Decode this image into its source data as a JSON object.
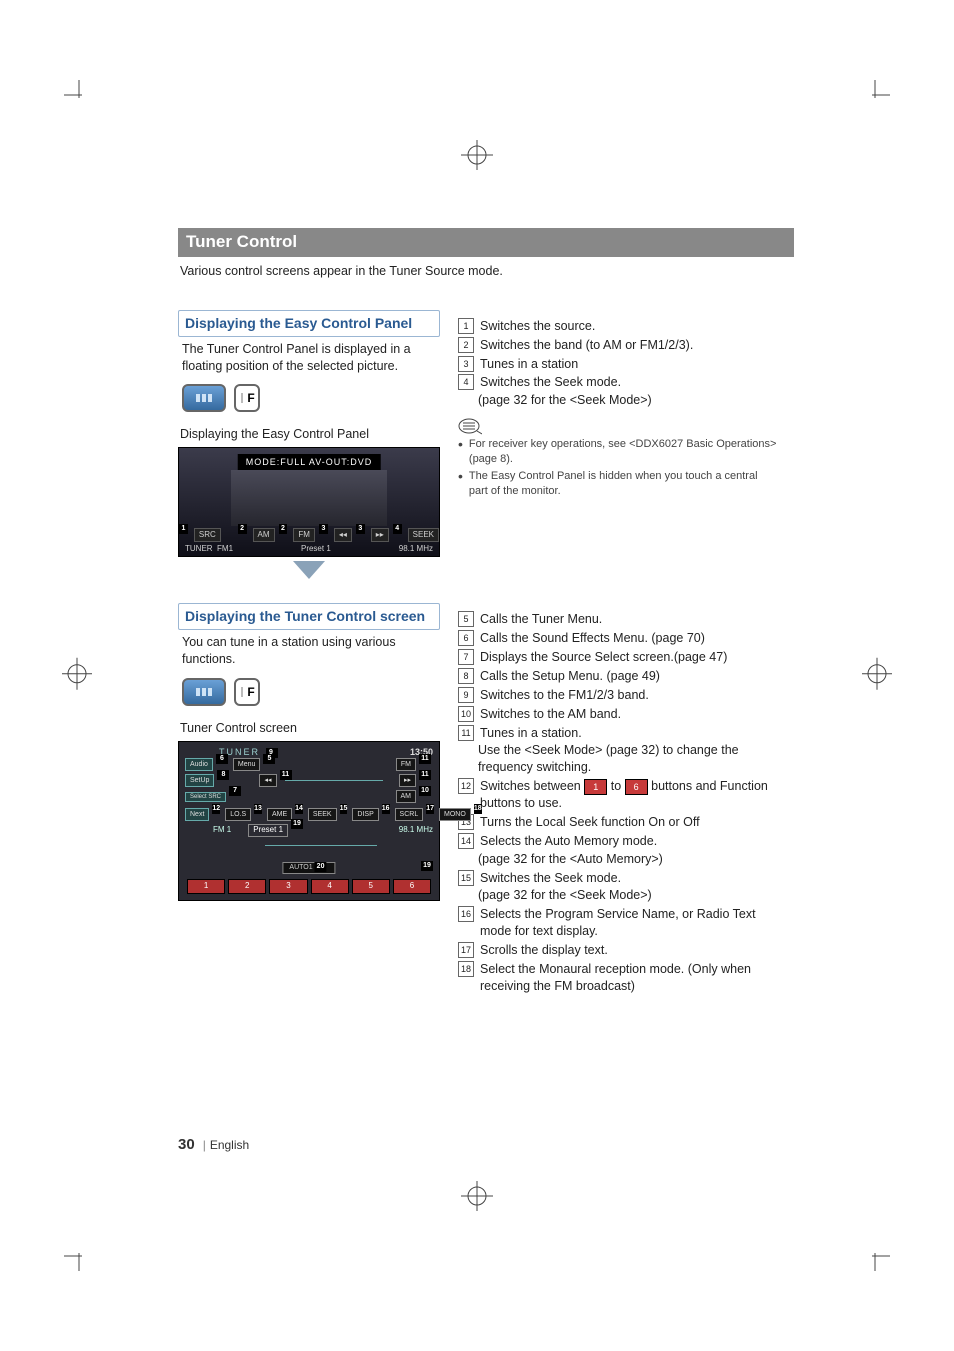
{
  "section_title": "Tuner Control",
  "intro": "Various control screens appear in the Tuner Source mode.",
  "easy_panel": {
    "heading": "Displaying the Easy Control Panel",
    "desc": "The Tuner Control Panel is displayed in a floating position of the selected picture.",
    "caption": "Displaying the Easy Control Panel",
    "mode_btn_label": "F",
    "screenshot": {
      "topbar": "MODE:FULL  AV-OUT:DVD",
      "btn_am": "AM",
      "btn_fm": "FM",
      "btn_prev": "◂◂",
      "btn_next": "▸▸",
      "btn_seek": "SEEK",
      "src_label": "SRC",
      "tuner_label": "TUNER",
      "band": "FM1",
      "preset": "Preset 1",
      "freq": "98.1 MHz"
    },
    "items": [
      {
        "n": "1",
        "text": "Switches the source."
      },
      {
        "n": "2",
        "text": "Switches the band (to AM or FM1/2/3)."
      },
      {
        "n": "3",
        "text": "Tunes in a station"
      },
      {
        "n": "4",
        "text": "Switches the Seek mode."
      }
    ],
    "item4_sub": "(page 32 for the <Seek Mode>)",
    "notes": [
      "For receiver key operations, see <DDX6027 Basic Operations> (page 8).",
      "The Easy Control Panel is hidden when you touch a central part of the monitor."
    ]
  },
  "tuner_screen": {
    "heading": "Displaying the Tuner Control screen",
    "desc": "You can tune in a station using various functions.",
    "mode_btn_label": "F",
    "caption": "Tuner Control screen",
    "screenshot": {
      "title": "TUNER",
      "clock": "13:50",
      "menu": "Menu",
      "audio": "Audio",
      "setup": "SetUp",
      "select_src": "Select SRC",
      "next": "Next",
      "fm": "FM",
      "am": "AM",
      "prev": "◂◂",
      "fwd": "▸▸",
      "lo_s": "LO.S",
      "ame": "AME",
      "seek": "SEEK",
      "disp": "DISP",
      "scrl": "SCRL",
      "mono": "MONO",
      "band": "FM 1",
      "preset": "Preset 1",
      "freq": "98.1 MHz",
      "auto": "AUTO1",
      "presets": [
        "1",
        "2",
        "3",
        "4",
        "5",
        "6"
      ]
    },
    "items": [
      {
        "n": "5",
        "text": "Calls the Tuner Menu."
      },
      {
        "n": "6",
        "text": "Calls the Sound Effects Menu. (page 70)"
      },
      {
        "n": "7",
        "text": "Displays the Source Select screen.(page 47)"
      },
      {
        "n": "8",
        "text": "Calls the Setup Menu. (page 49)"
      },
      {
        "n": "9",
        "text": "Switches to the FM1/2/3 band."
      },
      {
        "n": "10",
        "text": "Switches to the AM band."
      },
      {
        "n": "11",
        "text": "Tunes in a station."
      },
      {
        "n": "12",
        "text_pre": "Switches between ",
        "chip1": "1",
        "text_mid": " to ",
        "chip2": "6",
        "text_post": " buttons and Function buttons to use."
      },
      {
        "n": "13",
        "text": "Turns the Local Seek function On or Off"
      },
      {
        "n": "14",
        "text": "Selects the Auto Memory mode."
      },
      {
        "n": "15",
        "text": "Switches the Seek mode."
      },
      {
        "n": "16",
        "text": "Selects the Program Service Name, or Radio Text mode for text display."
      },
      {
        "n": "17",
        "text": "Scrolls the display text."
      },
      {
        "n": "18",
        "text": "Select the Monaural reception mode. (Only when receiving the FM broadcast)"
      }
    ],
    "item11_sub": "Use the <Seek Mode> (page 32) to change the frequency switching.",
    "item14_sub": "(page 32 for the <Auto Memory>)",
    "item15_sub": "(page 32 for the <Seek Mode>)"
  },
  "footer": {
    "page": "30",
    "lang": "English"
  }
}
